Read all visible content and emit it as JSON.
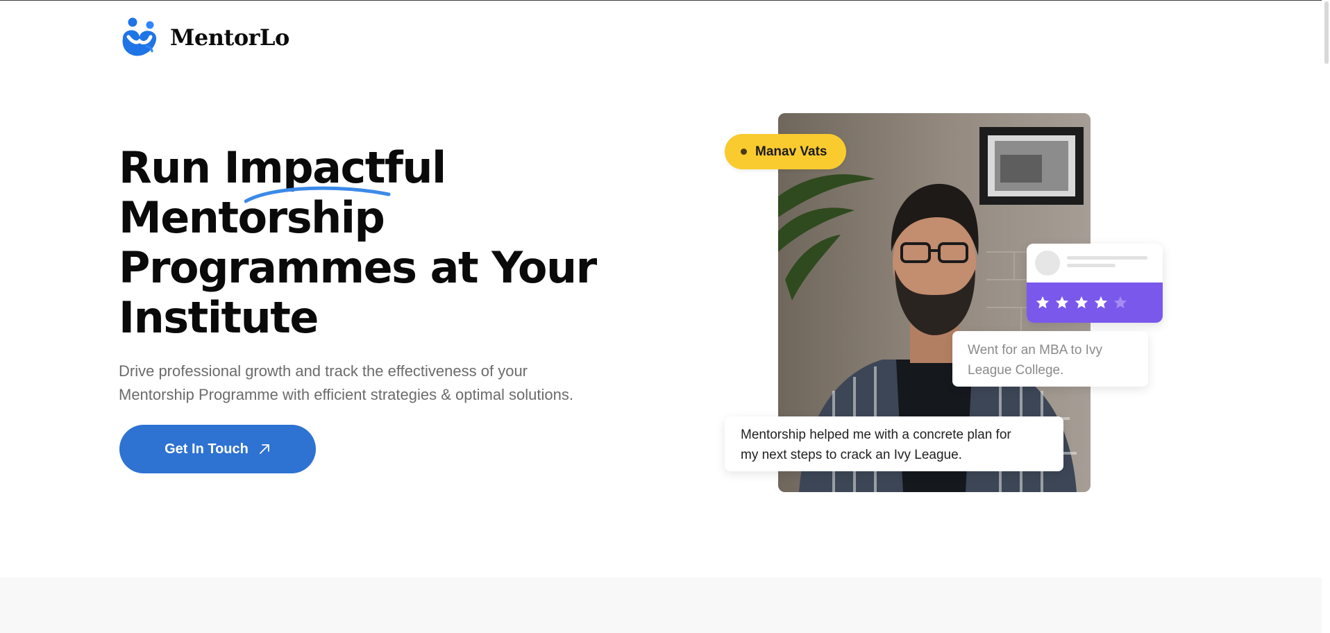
{
  "brand": {
    "name": "MentorLo",
    "logo_icon": "mentorlo-people-logo",
    "logo_colors": {
      "primary": "#1f74e6",
      "secondary": "#2f86ff"
    }
  },
  "hero": {
    "title_lines": [
      "Run Impactful",
      "Mentorship",
      "Programmes at Your",
      "Institute"
    ],
    "highlight_word": "Impactful",
    "highlight_color": "#3b8ae8",
    "subtitle_lines": [
      "Drive professional growth and track the effectiveness of your",
      "Mentorship Programme with efficient strategies & optimal solutions."
    ],
    "cta_label": "Get In Touch",
    "cta_icon": "arrow-up-right-icon",
    "cta_color": "#2e72d2"
  },
  "testimonial": {
    "name": "Manav Vats",
    "name_pill_color": "#f9cb2f",
    "rating_stars": 4,
    "rating_max": 5,
    "rating_color": "#7a58ec",
    "outcome_lines": [
      "Went for an MBA to Ivy",
      "League College."
    ],
    "quote_lines": [
      "Mentorship helped me with a concrete plan for",
      "my next steps to crack an Ivy League."
    ]
  }
}
